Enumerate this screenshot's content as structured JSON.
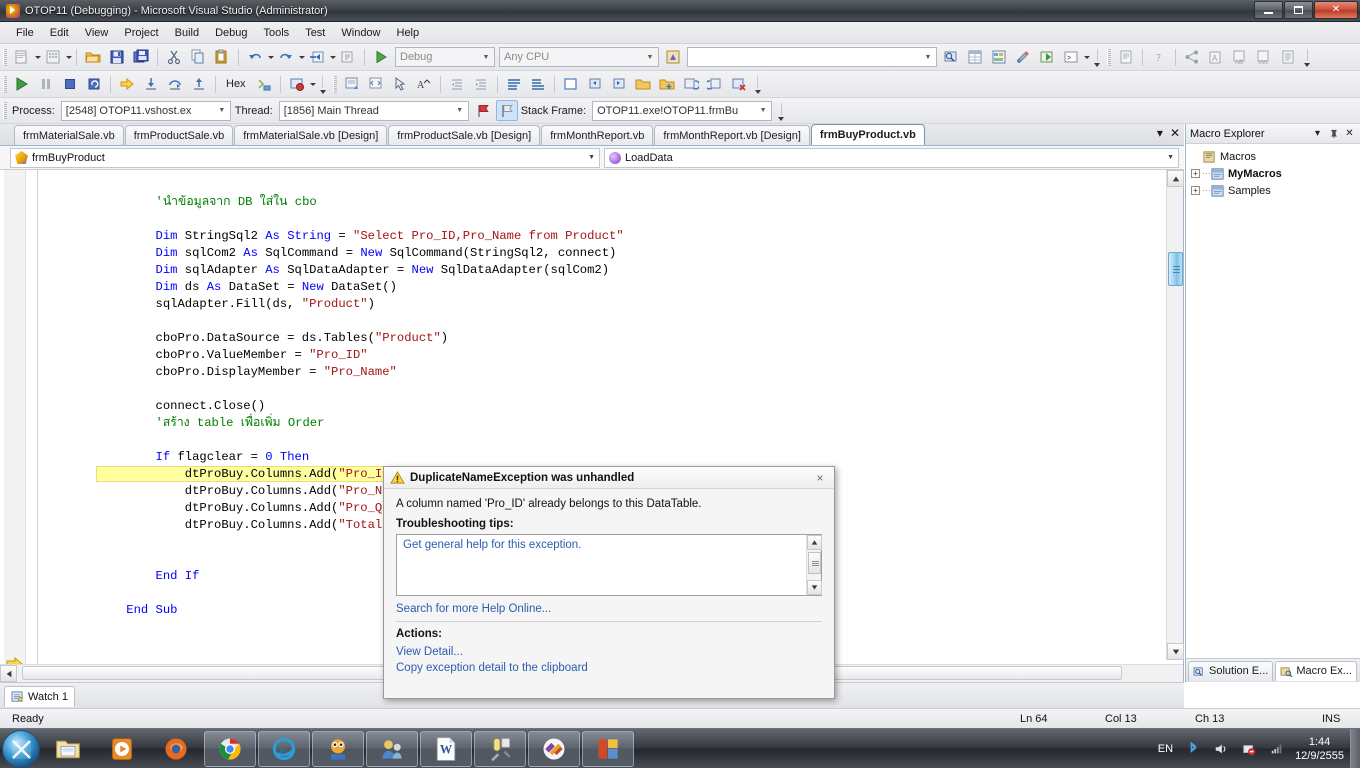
{
  "window": {
    "title": "OTOP11 (Debugging) - Microsoft Visual Studio (Administrator)",
    "minimize_label": "Minimize",
    "maximize_label": "Restore",
    "close_label": "Close"
  },
  "menu": {
    "items": [
      "File",
      "Edit",
      "View",
      "Project",
      "Build",
      "Debug",
      "Tools",
      "Test",
      "Window",
      "Help"
    ]
  },
  "toolbar_standard": {
    "config_combo": "Debug",
    "platform_combo": "Any CPU",
    "find_combo": ""
  },
  "toolbar_debug": {
    "hex_label": "Hex"
  },
  "debug_location": {
    "process_label": "Process:",
    "process_value": "[2548] OTOP11.vshost.ex",
    "thread_label": "Thread:",
    "thread_value": "[1856] Main Thread",
    "stackframe_label": "Stack Frame:",
    "stackframe_value": "OTOP11.exe!OTOP11.frmBu"
  },
  "document_tabs": {
    "items": [
      {
        "label": "frmMaterialSale.vb",
        "active": false
      },
      {
        "label": "frmProductSale.vb",
        "active": false
      },
      {
        "label": "frmMaterialSale.vb [Design]",
        "active": false
      },
      {
        "label": "frmProductSale.vb [Design]",
        "active": false
      },
      {
        "label": "frmMonthReport.vb",
        "active": false
      },
      {
        "label": "frmMonthReport.vb [Design]",
        "active": false
      },
      {
        "label": "frmBuyProduct.vb",
        "active": true
      }
    ]
  },
  "navigation_bar": {
    "class_combo": "frmBuyProduct",
    "member_combo": "LoadData"
  },
  "editor": {
    "code_lines": [
      {
        "indent": 8,
        "tokens": [
          {
            "t": "'นำข้อมูลจาก DB ใส่ใน cbo",
            "c": "cmt"
          }
        ]
      },
      {
        "indent": 0,
        "tokens": []
      },
      {
        "indent": 8,
        "tokens": [
          {
            "t": "Dim",
            "c": "kw"
          },
          {
            "t": " StringSql2 "
          },
          {
            "t": "As",
            "c": "kw"
          },
          {
            "t": " "
          },
          {
            "t": "String",
            "c": "kw"
          },
          {
            "t": " = "
          },
          {
            "t": "\"Select Pro_ID,Pro_Name from Product\"",
            "c": "str"
          }
        ]
      },
      {
        "indent": 8,
        "tokens": [
          {
            "t": "Dim",
            "c": "kw"
          },
          {
            "t": " sqlCom2 "
          },
          {
            "t": "As",
            "c": "kw"
          },
          {
            "t": " SqlCommand = "
          },
          {
            "t": "New",
            "c": "kw"
          },
          {
            "t": " SqlCommand(StringSql2, connect)"
          }
        ]
      },
      {
        "indent": 8,
        "tokens": [
          {
            "t": "Dim",
            "c": "kw"
          },
          {
            "t": " sqlAdapter "
          },
          {
            "t": "As",
            "c": "kw"
          },
          {
            "t": " SqlDataAdapter = "
          },
          {
            "t": "New",
            "c": "kw"
          },
          {
            "t": " SqlDataAdapter(sqlCom2)"
          }
        ]
      },
      {
        "indent": 8,
        "tokens": [
          {
            "t": "Dim",
            "c": "kw"
          },
          {
            "t": " ds "
          },
          {
            "t": "As",
            "c": "kw"
          },
          {
            "t": " DataSet = "
          },
          {
            "t": "New",
            "c": "kw"
          },
          {
            "t": " DataSet()"
          }
        ]
      },
      {
        "indent": 8,
        "tokens": [
          {
            "t": "sqlAdapter.Fill(ds, "
          },
          {
            "t": "\"Product\"",
            "c": "str"
          },
          {
            "t": ")"
          }
        ]
      },
      {
        "indent": 0,
        "tokens": []
      },
      {
        "indent": 8,
        "tokens": [
          {
            "t": "cboPro.DataSource = ds.Tables("
          },
          {
            "t": "\"Product\"",
            "c": "str"
          },
          {
            "t": ")"
          }
        ]
      },
      {
        "indent": 8,
        "tokens": [
          {
            "t": "cboPro.ValueMember = "
          },
          {
            "t": "\"Pro_ID\"",
            "c": "str"
          }
        ]
      },
      {
        "indent": 8,
        "tokens": [
          {
            "t": "cboPro.DisplayMember = "
          },
          {
            "t": "\"Pro_Name\"",
            "c": "str"
          }
        ]
      },
      {
        "indent": 0,
        "tokens": []
      },
      {
        "indent": 8,
        "tokens": [
          {
            "t": "connect.Close()"
          }
        ]
      },
      {
        "indent": 8,
        "tokens": [
          {
            "t": "'สร้าง table เพื่อเพิ่ม Order",
            "c": "cmt"
          }
        ]
      },
      {
        "indent": 0,
        "tokens": []
      },
      {
        "indent": 8,
        "tokens": [
          {
            "t": "If",
            "c": "kw"
          },
          {
            "t": " flagclear = "
          },
          {
            "t": "0",
            "c": "kw"
          },
          {
            "t": " "
          },
          {
            "t": "Then",
            "c": "kw"
          }
        ]
      },
      {
        "indent": 12,
        "highlight": true,
        "tokens": [
          {
            "t": "dtProBuy.Columns.Add("
          },
          {
            "t": "\"Pro_ID\"",
            "c": "str"
          },
          {
            "t": ")"
          }
        ]
      },
      {
        "indent": 12,
        "tokens": [
          {
            "t": "dtProBuy.Columns.Add("
          },
          {
            "t": "\"Pro_Name\"",
            "c": "str"
          },
          {
            "t": ")"
          }
        ]
      },
      {
        "indent": 12,
        "tokens": [
          {
            "t": "dtProBuy.Columns.Add("
          },
          {
            "t": "\"Pro_Qty\"",
            "c": "str"
          },
          {
            "t": ")"
          }
        ]
      },
      {
        "indent": 12,
        "tokens": [
          {
            "t": "dtProBuy.Columns.Add("
          },
          {
            "t": "\"TotalPrice\"",
            "c": "str"
          },
          {
            "t": ")"
          }
        ]
      },
      {
        "indent": 0,
        "tokens": []
      },
      {
        "indent": 0,
        "tokens": []
      },
      {
        "indent": 8,
        "tokens": [
          {
            "t": "End",
            "c": "kw"
          },
          {
            "t": " "
          },
          {
            "t": "If",
            "c": "kw"
          }
        ]
      },
      {
        "indent": 0,
        "tokens": []
      },
      {
        "indent": 4,
        "tokens": [
          {
            "t": "End",
            "c": "kw"
          },
          {
            "t": " "
          },
          {
            "t": "Sub",
            "c": "kw"
          }
        ]
      }
    ]
  },
  "exception_dialog": {
    "title": "DuplicateNameException was unhandled",
    "close_label": "×",
    "message": "A column named 'Pro_ID' already belongs to this DataTable.",
    "tips_label": "Troubleshooting tips:",
    "tips_link": "Get general help for this exception.",
    "help_online_link": "Search for more Help Online...",
    "actions_label": "Actions:",
    "actions": [
      "View Detail...",
      "Copy exception detail to the clipboard"
    ]
  },
  "macro_explorer": {
    "title": "Macro Explorer",
    "dropdown_label": "▾",
    "pin_label": "⊥",
    "close_label": "✕",
    "tree": [
      {
        "label": "Macros",
        "level": 0,
        "expander": null,
        "bold": false
      },
      {
        "label": "MyMacros",
        "level": 1,
        "expander": "+",
        "bold": true
      },
      {
        "label": "Samples",
        "level": 1,
        "expander": "+",
        "bold": false
      }
    ],
    "tabs": [
      {
        "label": "Solution E...",
        "active": false
      },
      {
        "label": "Macro Ex...",
        "active": true
      }
    ]
  },
  "watch_panel": {
    "tab_label": "Watch 1"
  },
  "status_bar": {
    "ready": "Ready",
    "line": "Ln 64",
    "column": "Col 13",
    "character": "Ch 13",
    "insert_mode": "INS"
  },
  "taskbar": {
    "start_label": "Start",
    "pinned": [
      {
        "name": "windows-explorer-icon",
        "open": false
      },
      {
        "name": "media-player-icon",
        "open": false
      },
      {
        "name": "firefox-icon",
        "open": false
      }
    ],
    "running": [
      {
        "name": "chrome-icon"
      },
      {
        "name": "internet-explorer-icon"
      },
      {
        "name": "camfrog-icon"
      },
      {
        "name": "msn-messenger-icon"
      },
      {
        "name": "microsoft-word-icon"
      },
      {
        "name": "sql-tools-icon"
      },
      {
        "name": "visual-studio-icon"
      },
      {
        "name": "powerpoint-icon"
      }
    ],
    "tray": {
      "language": "EN",
      "time": "1:44",
      "date": "12/9/2555"
    }
  },
  "colors": {
    "keyword": "#0000ff",
    "string": "#a31515",
    "comment": "#008000",
    "highlight": "#ffffa0",
    "link": "#2a5db0",
    "titlebar": "#3e4349"
  }
}
